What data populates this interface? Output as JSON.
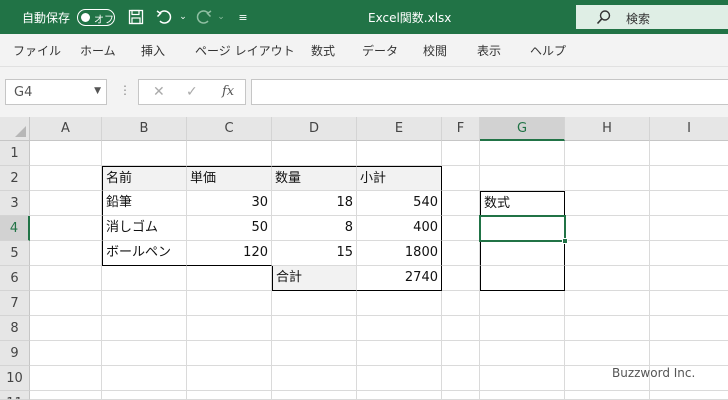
{
  "titlebar": {
    "autosave_label": "自動保存",
    "autosave_state": "オフ",
    "filename": "Excel関数.xlsx",
    "search_placeholder": "検索",
    "accent": "#217346"
  },
  "ribbon": {
    "tabs": [
      "ファイル",
      "ホーム",
      "挿入",
      "ページ レイアウト",
      "数式",
      "データ",
      "校閲",
      "表示",
      "ヘルプ"
    ]
  },
  "formula_bar": {
    "name_box": "G4",
    "fx_label": "fx",
    "formula": ""
  },
  "sheet": {
    "columns": [
      "A",
      "B",
      "C",
      "D",
      "E",
      "F",
      "G",
      "H",
      "I"
    ],
    "active_column": "G",
    "rows": [
      "1",
      "2",
      "3",
      "4",
      "5",
      "6",
      "7",
      "8",
      "9",
      "10",
      "11"
    ],
    "active_row": "4",
    "cells": {
      "B2": "名前",
      "C2": "単価",
      "D2": "数量",
      "E2": "小計",
      "B3": "鉛筆",
      "C3": "30",
      "D3": "18",
      "E3": "540",
      "B4": "消しゴム",
      "C4": "50",
      "D4": "8",
      "E4": "400",
      "B5": "ボールペン",
      "C5": "120",
      "D5": "15",
      "E5": "1800",
      "D6": "合計",
      "E6": "2740",
      "G3": "数式"
    },
    "selected_cell": "G4"
  },
  "watermark": "Buzzword Inc."
}
